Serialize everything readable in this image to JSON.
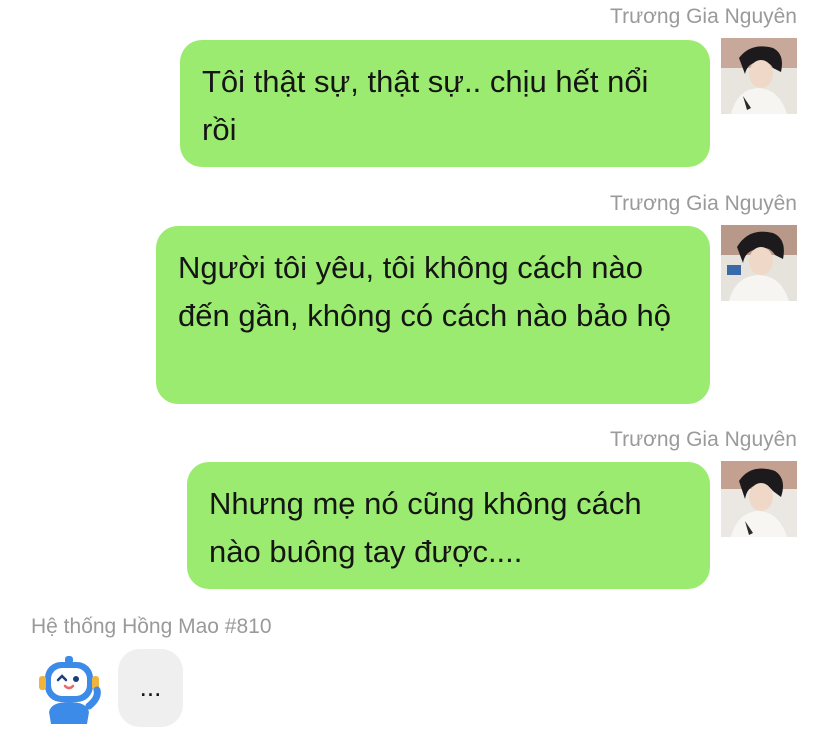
{
  "messages": [
    {
      "sender": "Trương Gia Nguyên",
      "text": "Tôi thật sự, thật sự.. chịu hết nổi rồi",
      "side": "right"
    },
    {
      "sender": "Trương Gia Nguyên",
      "text": "Người tôi yêu, tôi không cách nào đến gần, không có cách nào bảo hộ",
      "side": "right"
    },
    {
      "sender": "Trương Gia Nguyên",
      "text": "Nhưng mẹ nó cũng không cách nào buông tay được....",
      "side": "right"
    },
    {
      "sender": "Hệ thống Hồng Mao #810",
      "text": "...",
      "side": "left"
    }
  ],
  "colors": {
    "my_bubble": "#9beb70",
    "their_bubble": "#efefef",
    "sender_name": "#9a9a9a",
    "robot_blue": "#3d8be8"
  },
  "icons": {
    "user_avatar": "photo-avatar-icon",
    "system_avatar": "robot-mascot-icon"
  }
}
